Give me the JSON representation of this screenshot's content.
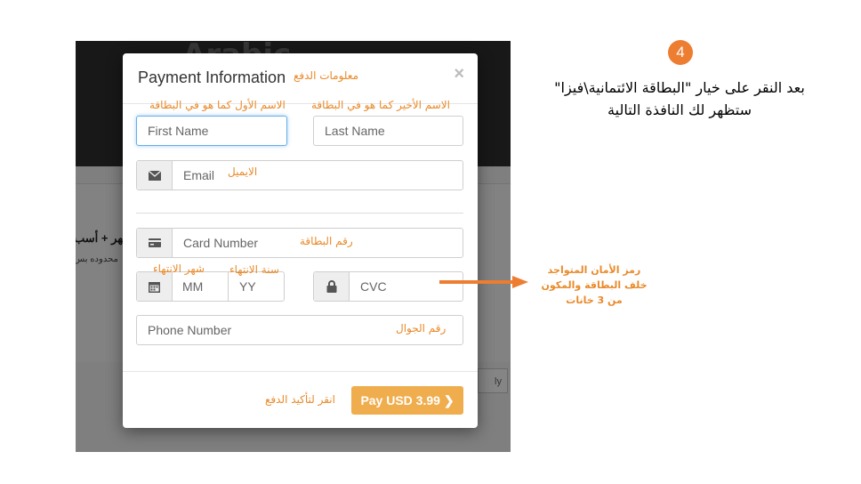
{
  "background_app": {
    "logo": "Arabic",
    "promo_title": "شهر + أسب",
    "promo_sub": "محدوده بس",
    "footer_button": "ly"
  },
  "modal": {
    "title": "Payment Information",
    "close_label": "×",
    "fields": {
      "first_name_placeholder": "First Name",
      "last_name_placeholder": "Last Name",
      "email_placeholder": "Email",
      "card_number_placeholder": "Card Number",
      "month_placeholder": "MM",
      "year_placeholder": "YY",
      "cvc_placeholder": "CVC",
      "phone_placeholder": "Phone Number"
    },
    "icons": {
      "email": "envelope-icon",
      "card": "credit-card-icon",
      "expiry": "calendar-icon",
      "cvc": "lock-icon"
    },
    "pay_button_label": "Pay USD 3.99",
    "pay_button_color": "#f0ad4e"
  },
  "annotations": {
    "title": "معلومات الدفع",
    "first_name": "الاسم الأول كما هو في البطاقة",
    "last_name": "الاسم الأخير كما هو في البطاقة",
    "email": "الايميل",
    "card_number": "رقم البطاقة",
    "expiry_month": "شهر الانتهاء",
    "expiry_year": "سنة الانتهاء",
    "phone": "رقم الجوال",
    "pay": "انقر لتأكيد الدفع",
    "cvc_note_line1": "رمز الأمان المتواجد",
    "cvc_note_line2": "خلف البطاقة والمكون",
    "cvc_note_line3": "من 3 خانات",
    "color": "#e98a2a"
  },
  "slide": {
    "step_number": "4",
    "step_color": "#ed7d31",
    "instruction_line1": "بعد النقر على خيار \"البطاقة الائتمانية\\فيزا\"",
    "instruction_line2": "ستظهر لك النافذة التالية"
  }
}
